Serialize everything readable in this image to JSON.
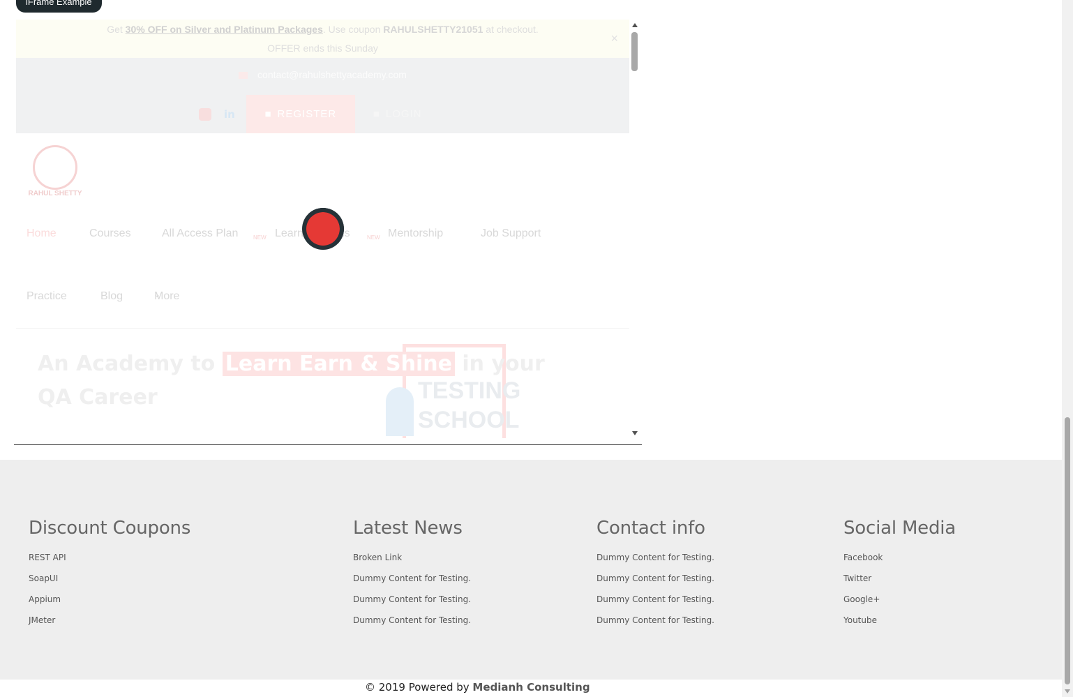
{
  "iframe": {
    "badge_label": "iFrame Example",
    "promo": {
      "prefix": "Get ",
      "offer_link": "30% OFF on Silver and Platinum Packages",
      "middle": ". Use coupon ",
      "coupon": "RAHULSHETTY21051",
      "suffix": " at checkout.",
      "line2": "OFFER ends this Sunday",
      "close": "×"
    },
    "contact_email": "contact@rahulshettyacademy.com",
    "register_label": "REGISTER",
    "login_label": "LOGIN",
    "linkedin_label": "in",
    "logo_text": "RAHUL SHETTY",
    "nav": {
      "home": "Home",
      "courses": "Courses",
      "all_access": "All Access Plan",
      "learning_paths": "Learning Paths",
      "new_badge": "NEW",
      "mentorship": "Mentorship",
      "job_support": "Job Support",
      "practice": "Practice",
      "blog": "Blog",
      "more": "More"
    },
    "hero": {
      "title_prefix": "An Academy to ",
      "title_highlight": "Learn Earn & Shine",
      "title_suffix": " in your QA Career",
      "image_text_1": "TESTING",
      "image_text_2": "SCHOOL"
    }
  },
  "footer": {
    "columns": [
      {
        "heading": "Discount Coupons",
        "items": [
          "REST API",
          "SoapUI",
          "Appium",
          "JMeter"
        ]
      },
      {
        "heading": "Latest News",
        "items": [
          "Broken Link",
          "Dummy Content for Testing.",
          "Dummy Content for Testing.",
          "Dummy Content for Testing."
        ]
      },
      {
        "heading": "Contact info",
        "items": [
          "Dummy Content for Testing.",
          "Dummy Content for Testing.",
          "Dummy Content for Testing.",
          "Dummy Content for Testing."
        ]
      },
      {
        "heading": "Social Media",
        "items": [
          "Facebook",
          "Twitter",
          "Google+",
          "Youtube"
        ]
      }
    ],
    "copyright_prefix": "© 2019 Powered by ",
    "copyright_link": "Medianh Consulting"
  },
  "colors": {
    "footer_bg": "#eeeeee",
    "spinner_red": "#e53935",
    "spinner_dark": "#263238"
  }
}
